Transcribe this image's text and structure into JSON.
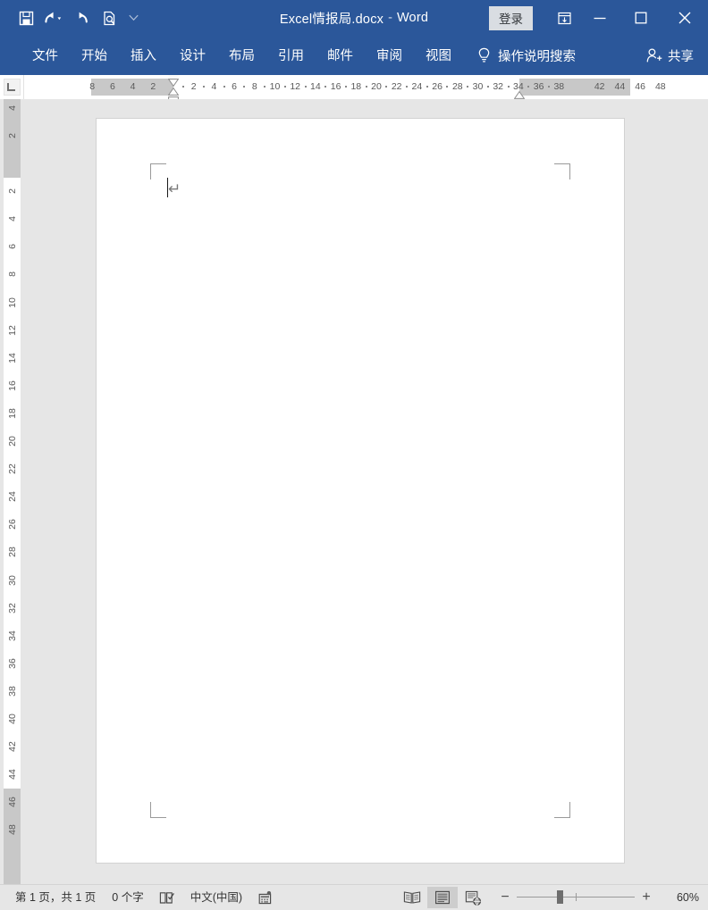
{
  "window": {
    "title": "Excel情报局.docx",
    "separator": "-",
    "app_name": "Word",
    "signin_label": "登录",
    "brand_color": "#2b579a",
    "quick_access": [
      {
        "name": "save-icon",
        "label": "保存"
      },
      {
        "name": "undo-icon",
        "label": "撤消"
      },
      {
        "name": "redo-icon",
        "label": "恢复"
      },
      {
        "name": "print-preview-icon",
        "label": "打印预览和打印"
      },
      {
        "name": "customize-qat-icon",
        "label": "自定义快速访问工具栏"
      }
    ],
    "controls": [
      {
        "name": "ribbon-display-options-icon",
        "label": "功能区显示选项"
      },
      {
        "name": "minimize-icon",
        "label": "最小化"
      },
      {
        "name": "maximize-icon",
        "label": "最大化"
      },
      {
        "name": "close-icon",
        "label": "关闭"
      }
    ]
  },
  "ribbon": {
    "tabs": [
      {
        "label": "文件",
        "active": false
      },
      {
        "label": "开始",
        "active": false
      },
      {
        "label": "插入",
        "active": false
      },
      {
        "label": "设计",
        "active": false
      },
      {
        "label": "布局",
        "active": false
      },
      {
        "label": "引用",
        "active": false
      },
      {
        "label": "邮件",
        "active": false
      },
      {
        "label": "审阅",
        "active": false
      },
      {
        "label": "视图",
        "active": false
      }
    ],
    "tell_me": {
      "label": "操作说明搜索",
      "icon": "lightbulb-icon"
    },
    "share": {
      "label": "共享",
      "icon": "share-person-icon"
    }
  },
  "ruler": {
    "tab_selector": "left-tab-stop",
    "horizontal": {
      "unit": "字符",
      "left_gray_labels": [
        "8",
        "6",
        "4",
        "2"
      ],
      "white_labels": [
        "2",
        "4",
        "6",
        "8",
        "10",
        "12",
        "14",
        "16",
        "18",
        "20",
        "22",
        "24",
        "26",
        "28",
        "30",
        "32",
        "34",
        "36",
        "38"
      ],
      "right_gray_labels": [
        "42",
        "44",
        "46",
        "48"
      ],
      "first_line_indent": 0,
      "left_indent": 0,
      "right_indent": 40
    },
    "vertical": {
      "top_gray_labels": [
        "4",
        "2"
      ],
      "white_labels": [
        "2",
        "4",
        "6",
        "8",
        "10",
        "12",
        "14",
        "16",
        "18",
        "20",
        "22",
        "24",
        "26",
        "28",
        "30",
        "32",
        "34",
        "36",
        "38",
        "40",
        "42",
        "44"
      ],
      "bottom_gray_labels": [
        "46",
        "48"
      ]
    }
  },
  "document": {
    "paragraph_mark": "↵",
    "page_count": 1,
    "margin_marks": [
      "top-left",
      "top-right",
      "bottom-left",
      "bottom-right"
    ]
  },
  "statusbar": {
    "page_info": "第 1 页，共 1 页",
    "word_count": "0 个字",
    "proofing_icon": "proofing-errors-icon",
    "language": "中文(中国)",
    "macro_icon": "macro-recording-icon",
    "views": [
      {
        "name": "read-mode-button",
        "label": "阅读视图",
        "active": false
      },
      {
        "name": "print-layout-button",
        "label": "页面视图",
        "active": true
      },
      {
        "name": "web-layout-button",
        "label": "Web 版式视图",
        "active": false
      }
    ],
    "zoom_out_label": "−",
    "zoom_in_label": "+",
    "zoom_level": "60%",
    "zoom_percent": 60
  }
}
